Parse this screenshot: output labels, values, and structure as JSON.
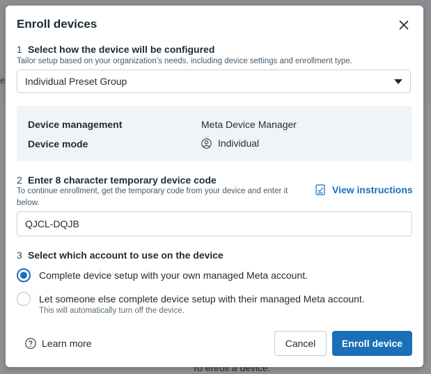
{
  "background": {
    "left_fragment": "e",
    "bottom_fragment": "To enroll a device:"
  },
  "dialog": {
    "title": "Enroll devices",
    "close_icon": "close-icon"
  },
  "step1": {
    "number": "1",
    "heading": "Select how the device will be configured",
    "subtext": "Tailor setup based on your organization’s needs, including device settings and enrollment type.",
    "select_value": "Individual Preset Group"
  },
  "info": {
    "management_label": "Device management",
    "management_value": "Meta Device Manager",
    "mode_label": "Device mode",
    "mode_value": "Individual",
    "mode_icon": "person-icon"
  },
  "step2": {
    "number": "2",
    "heading": "Enter 8 character temporary device code",
    "subtext_line1": "To continue enrollment, get the temporary code from your device and enter it",
    "subtext_line2": "below.",
    "view_instructions": "View instructions",
    "code_value": "QJCL-DQJB"
  },
  "step3": {
    "number": "3",
    "heading": "Select which account to use on the device",
    "options": [
      {
        "label": "Complete device setup with your own managed Meta account.",
        "selected": true
      },
      {
        "label": "Let someone else complete device setup with their managed Meta account.",
        "selected": false
      }
    ],
    "option2_note": "This will automatically turn off the device."
  },
  "footer": {
    "learn_more": "Learn more",
    "cancel": "Cancel",
    "enroll": "Enroll device"
  },
  "colors": {
    "accent": "#1a6fb8",
    "info_bg": "#f1f4f7",
    "text": "#1c2b33"
  }
}
